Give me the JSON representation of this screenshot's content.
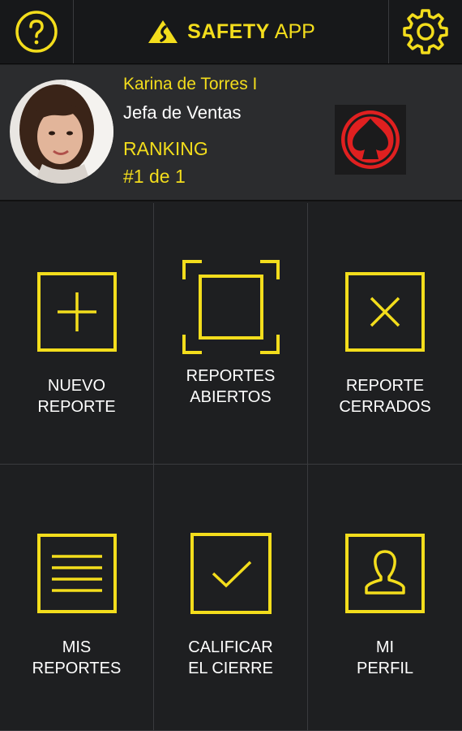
{
  "header": {
    "brand_name": "SAFETY",
    "brand_suffix": "APP",
    "help_icon": "question-circle-icon",
    "settings_icon": "gear-icon"
  },
  "profile": {
    "name": "Karina de Torres I",
    "role": "Jefa de Ventas",
    "ranking_label": "RANKING",
    "ranking_value": "#1 de 1"
  },
  "menu": {
    "tiles": [
      {
        "line1": "NUEVO",
        "line2": "REPORTE",
        "icon": "plus-square-icon"
      },
      {
        "line1": "REPORTES",
        "line2": "ABIERTOS",
        "icon": "open-square-icon"
      },
      {
        "line1": "REPORTE",
        "line2": "CERRADOS",
        "icon": "x-square-icon"
      },
      {
        "line1": "MIS",
        "line2": "REPORTES",
        "icon": "list-square-icon"
      },
      {
        "line1": "CALIFICAR",
        "line2": "EL CIERRE",
        "icon": "check-square-icon"
      },
      {
        "line1": "MI",
        "line2": "PERFIL",
        "icon": "user-square-icon"
      }
    ]
  },
  "colors": {
    "accent": "#f3dd1c",
    "background": "#1e1f21",
    "profile_bg": "#2b2c2e",
    "badge_red": "#e02020"
  }
}
